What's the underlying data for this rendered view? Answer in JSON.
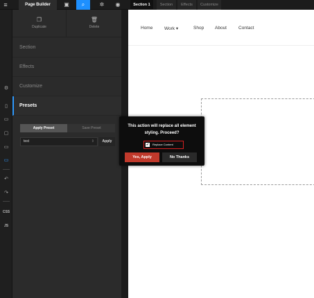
{
  "topbar": {
    "menu_icon": "hamburger-icon",
    "brand": "Page Builder",
    "icons": [
      "panel-icon",
      "search-icon",
      "gear-icon",
      "wordpress-icon"
    ],
    "tabs": [
      {
        "label": "Section 1",
        "active": true
      },
      {
        "label": "Section",
        "active": false
      },
      {
        "label": "Effects",
        "active": false
      },
      {
        "label": "Customize",
        "active": false
      }
    ]
  },
  "rail": {
    "icons": [
      "settings-code-icon",
      "page-icon",
      "section-icon",
      "tablet-icon",
      "desktop-icon",
      "mobile-icon",
      "undo-icon",
      "redo-icon"
    ],
    "css_label": "CSS",
    "js_label": "JS"
  },
  "panel": {
    "duplicate_label": "Duplicate",
    "delete_label": "Delete",
    "sections": [
      "Section",
      "Effects",
      "Customize",
      "Presets"
    ],
    "active_section": "Presets",
    "preset_tabs": [
      "Apply Preset",
      "Save Preset"
    ],
    "preset_value": "test",
    "apply_label": "Apply"
  },
  "canvas": {
    "nav": [
      "Home",
      "Work",
      "Shop",
      "About",
      "Contact"
    ],
    "work_chevron": "▾"
  },
  "modal": {
    "message": "This action will replace all element styling. Proceed?",
    "checkbox_label": "Replace Content",
    "checkbox_checked": true,
    "yes_label": "Yes, Apply",
    "no_label": "No Thanks",
    "accent": "#c0392b"
  }
}
